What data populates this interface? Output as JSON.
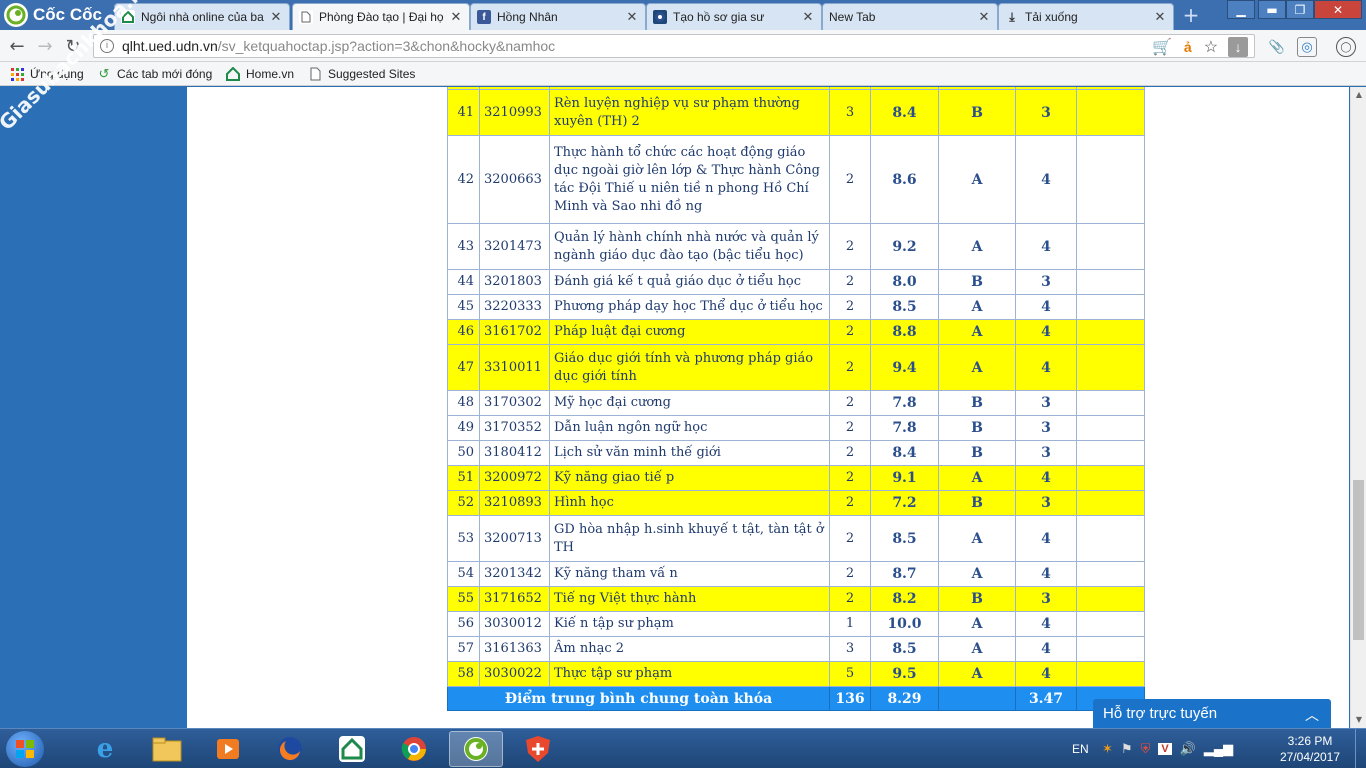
{
  "browser": {
    "brand": "Cốc Cốc",
    "tabs": [
      {
        "label": "Ngôi nhà online của ba",
        "favicon": "home-vn-icon",
        "active": false
      },
      {
        "label": "Phòng Đào tạo | Đại họ",
        "favicon": "page-icon",
        "active": true
      },
      {
        "label": "Hồng Nhân",
        "favicon": "facebook-icon",
        "active": false
      },
      {
        "label": "Tạo hồ sơ gia sư",
        "favicon": "tutor-site-icon",
        "active": false
      },
      {
        "label": "New Tab",
        "favicon": "none",
        "active": false
      },
      {
        "label": "Tải xuống",
        "favicon": "download-icon",
        "active": false
      }
    ],
    "address": {
      "host": "qlht.ued.udn.vn",
      "path": "/sv_ketquahoctap.jsp?action=3&chon&hocky&namhoc"
    },
    "bookmarks": [
      {
        "label": "Ứng dụng",
        "icon": "apps-grid-icon"
      },
      {
        "label": "Các tab mới đóng",
        "icon": "history-icon"
      },
      {
        "label": "Home.vn",
        "icon": "home-vn-icon"
      },
      {
        "label": "Suggested Sites",
        "icon": "page-icon"
      }
    ]
  },
  "watermark": "Giasubachkhoa.net",
  "grades": {
    "rows": [
      {
        "stt": "41",
        "code": "3210993",
        "name": "Rèn luyện nghiệp vụ sư phạm thường xuyên (TH) 2",
        "credits": "3",
        "score": "8.4",
        "letter": "B",
        "points": "3",
        "highlight": true
      },
      {
        "stt": "42",
        "code": "3200663",
        "name": "Thực hành tổ chức các hoạt động giáo dục ngoài giờ lên lớp & Thực hành Công tác Đội Thiế u niên tiề n phong Hồ Chí Minh và Sao nhi đồ ng",
        "credits": "2",
        "score": "8.6",
        "letter": "A",
        "points": "4",
        "highlight": false
      },
      {
        "stt": "43",
        "code": "3201473",
        "name": "Quản lý hành chính nhà nước và quản lý ngành giáo dục đào tạo (bậc tiểu học)",
        "credits": "2",
        "score": "9.2",
        "letter": "A",
        "points": "4",
        "highlight": false
      },
      {
        "stt": "44",
        "code": "3201803",
        "name": "Đánh giá kế t quả giáo dục ở tiểu học",
        "credits": "2",
        "score": "8.0",
        "letter": "B",
        "points": "3",
        "highlight": false
      },
      {
        "stt": "45",
        "code": "3220333",
        "name": "Phương pháp dạy học Thể dục ở tiểu học",
        "credits": "2",
        "score": "8.5",
        "letter": "A",
        "points": "4",
        "highlight": false
      },
      {
        "stt": "46",
        "code": "3161702",
        "name": "Pháp luật đại cương",
        "credits": "2",
        "score": "8.8",
        "letter": "A",
        "points": "4",
        "highlight": true
      },
      {
        "stt": "47",
        "code": "3310011",
        "name": "Giáo dục giới tính và phương pháp giáo dục giới tính",
        "credits": "2",
        "score": "9.4",
        "letter": "A",
        "points": "4",
        "highlight": true
      },
      {
        "stt": "48",
        "code": "3170302",
        "name": "Mỹ học đại cương",
        "credits": "2",
        "score": "7.8",
        "letter": "B",
        "points": "3",
        "highlight": false
      },
      {
        "stt": "49",
        "code": "3170352",
        "name": "Dẫn luận ngôn ngữ học",
        "credits": "2",
        "score": "7.8",
        "letter": "B",
        "points": "3",
        "highlight": false
      },
      {
        "stt": "50",
        "code": "3180412",
        "name": "Lịch sử văn minh thế giới",
        "credits": "2",
        "score": "8.4",
        "letter": "B",
        "points": "3",
        "highlight": false
      },
      {
        "stt": "51",
        "code": "3200972",
        "name": "Kỹ năng giao tiế p",
        "credits": "2",
        "score": "9.1",
        "letter": "A",
        "points": "4",
        "highlight": true
      },
      {
        "stt": "52",
        "code": "3210893",
        "name": "Hình học",
        "credits": "2",
        "score": "7.2",
        "letter": "B",
        "points": "3",
        "highlight": true
      },
      {
        "stt": "53",
        "code": "3200713",
        "name": "GD hòa nhập h.sinh khuyế t tật, tàn tật ở TH",
        "credits": "2",
        "score": "8.5",
        "letter": "A",
        "points": "4",
        "highlight": false
      },
      {
        "stt": "54",
        "code": "3201342",
        "name": "Kỹ năng tham vấ n",
        "credits": "2",
        "score": "8.7",
        "letter": "A",
        "points": "4",
        "highlight": false
      },
      {
        "stt": "55",
        "code": "3171652",
        "name": "Tiế ng Việt thực hành",
        "credits": "2",
        "score": "8.2",
        "letter": "B",
        "points": "3",
        "highlight": true
      },
      {
        "stt": "56",
        "code": "3030012",
        "name": "Kiế n tập sư phạm",
        "credits": "1",
        "score": "10.0",
        "letter": "A",
        "points": "4",
        "highlight": false
      },
      {
        "stt": "57",
        "code": "3161363",
        "name": "Âm nhạc 2",
        "credits": "3",
        "score": "8.5",
        "letter": "A",
        "points": "4",
        "highlight": false
      },
      {
        "stt": "58",
        "code": "3030022",
        "name": "Thực tập sư phạm",
        "credits": "5",
        "score": "9.5",
        "letter": "A",
        "points": "4",
        "highlight": true
      }
    ],
    "summary": {
      "label": "Điểm trung bình chung toàn khóa",
      "credits": "136",
      "score": "8.29",
      "points": "3.47"
    }
  },
  "chat_widget": {
    "label": "Hỗ trợ trực tuyến"
  },
  "taskbar": {
    "apps": [
      "internet-explorer-icon",
      "file-explorer-icon",
      "media-player-icon",
      "firefox-icon",
      "home-vn-icon",
      "chrome-icon",
      "coccoc-icon",
      "security-shield-icon"
    ],
    "language": "EN",
    "time": "3:26 PM",
    "date": "27/04/2017"
  },
  "colors": {
    "page_bg": "#2b6fb6",
    "row_highlight": "#ffff00",
    "summary_bg": "#1e8ff0",
    "chrome_blue": "#3c6fb0"
  }
}
